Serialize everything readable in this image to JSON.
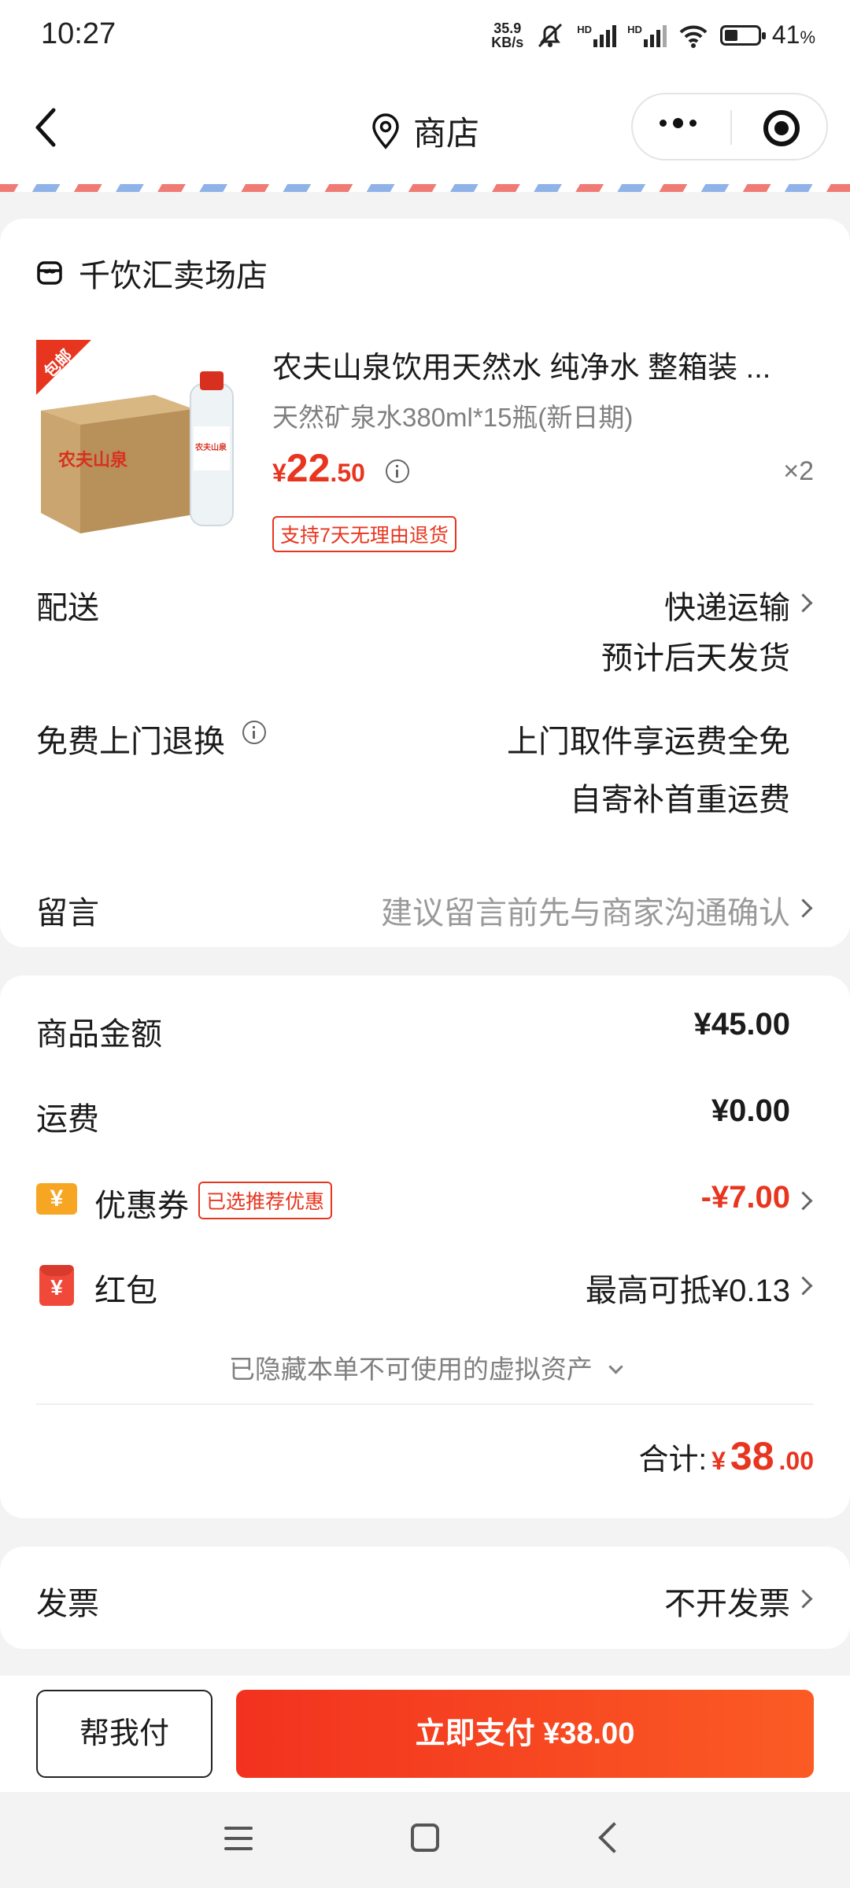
{
  "status": {
    "time": "10:27",
    "net_speed_value": "35.9",
    "net_speed_unit": "KB/s",
    "battery": "41",
    "battery_unit": "%",
    "battery_level": 0.41,
    "hd1": "HD",
    "hd2": "HD"
  },
  "nav": {
    "title": "商店"
  },
  "store": {
    "name": "千饮汇卖场店"
  },
  "product": {
    "title": "农夫山泉饮用天然水 纯净水 整箱装 ...",
    "spec": "天然矿泉水380ml*15瓶(新日期)",
    "price_currency": "¥",
    "price_int": "22",
    "price_dec": ".50",
    "quantity": "×2",
    "return_tag": "支持7天无理由退货",
    "badge": "包邮",
    "box_brand": "农夫山泉",
    "bottle_brand": "农夫山泉"
  },
  "delivery": {
    "label": "配送",
    "method": "快递运输",
    "eta": "预计后天发货"
  },
  "free_return": {
    "label": "免费上门退换",
    "line1": "上门取件享运费全免",
    "line2": "自寄补首重运费"
  },
  "message": {
    "label": "留言",
    "placeholder": "建议留言前先与商家沟通确认"
  },
  "summary": {
    "goods_label": "商品金额",
    "goods_value": "¥45.00",
    "shipping_label": "运费",
    "shipping_value": "¥0.00",
    "coupon_icon": "¥",
    "coupon_label": "优惠券",
    "coupon_tag": "已选推荐优惠",
    "coupon_value": "-¥7.00",
    "hongbao_icon": "¥",
    "hongbao_label": "红包",
    "hongbao_value": "最高可抵¥0.13",
    "hidden_assets": "已隐藏本单不可使用的虚拟资产",
    "total_label": "合计:",
    "total_currency": "¥",
    "total_int": "38",
    "total_dec": ".00"
  },
  "invoice": {
    "label": "发票",
    "value": "不开发票"
  },
  "actions": {
    "help_pay": "帮我付",
    "pay_now": "立即支付 ¥38.00"
  },
  "colors": {
    "accent": "#e8351f",
    "button_gradient_start": "#f2321f",
    "button_gradient_end": "#fb5b24"
  }
}
